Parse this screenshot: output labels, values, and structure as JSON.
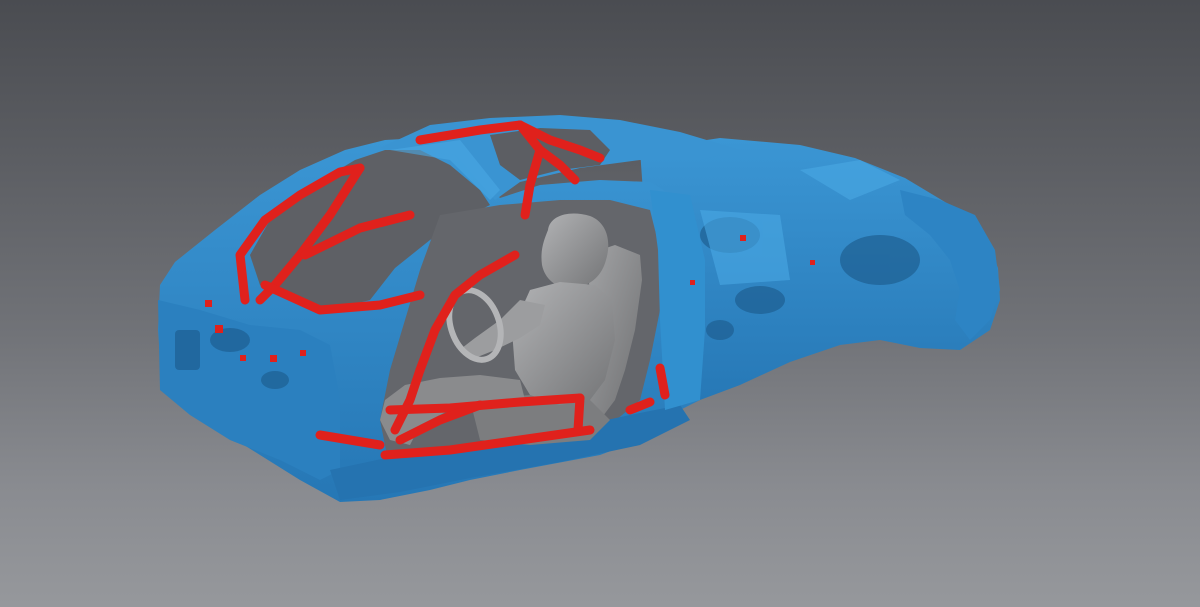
{
  "scene": {
    "description_hidden": "",
    "colors": {
      "background_top": "#4a4c51",
      "background_bottom": "#96989c",
      "body_shell": "#2e86c6",
      "body_shell_shadow": "#1f6aa3",
      "body_shell_highlight": "#49a3de",
      "roll_cage": "#e0211c",
      "roll_cage_dark": "#a91510",
      "driver_model": "#8e8f91",
      "driver_model_dark": "#5d5e60"
    },
    "objects": [
      {
        "name": "car-body-shell"
      },
      {
        "name": "roll-cage"
      },
      {
        "name": "driver-model"
      },
      {
        "name": "racing-seat"
      }
    ]
  }
}
